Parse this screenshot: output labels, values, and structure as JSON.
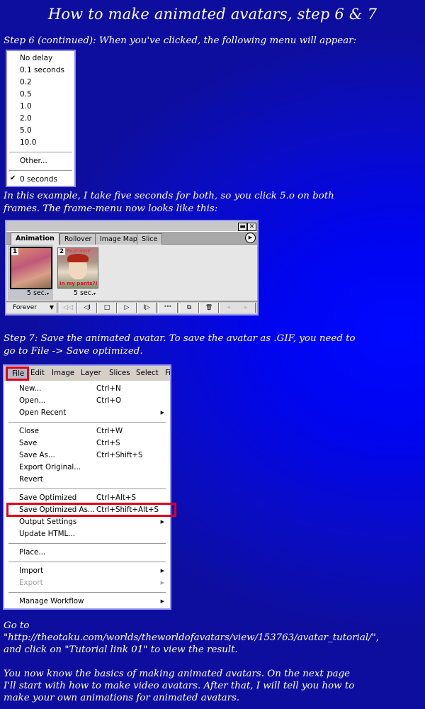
{
  "title": "How to make animated avatars, step 6 & 7",
  "step6_intro": "Step 6 (continued): When you've clicked, the following menu will appear:",
  "delay_menu": {
    "items": [
      "No delay",
      "0.1 seconds",
      "0.2",
      "0.5",
      "1.0",
      "2.0",
      "5.0",
      "10.0"
    ],
    "other": "Other...",
    "checked": "0 seconds",
    "check_glyph": "✔"
  },
  "example_text": {
    "line1": "In this example, I take five seconds for both, so you click 5.o on both",
    "line2": "frames. The frame-menu now looks like this:"
  },
  "animation_panel": {
    "minimize_glyph": "▬",
    "close_glyph": "✕",
    "tabs": [
      "Animation",
      "Rollover",
      "Image Map",
      "Slice"
    ],
    "active_tab": "Animation",
    "menu_glyph": "▶",
    "frames": [
      {
        "number": "1",
        "delay": "5 sec.",
        "selected": true
      },
      {
        "number": "2",
        "delay": "5 sec.",
        "selected": false,
        "caption_top": "Yourname",
        "caption_bottom": "In my pants?!"
      }
    ],
    "loop_option": "Forever",
    "dropdown_glyph": "▼",
    "controls": {
      "first": "◁◁",
      "prev": "◁I",
      "stop": "□",
      "play": "▷",
      "next": "I▷",
      "tween": "°°°",
      "duplicate": "⧉",
      "delete": "🗑"
    }
  },
  "step7_text": {
    "line1": "Step 7: Save the animated avatar. To save the avatar as .GIF, you need to",
    "line2": "go to File -> Save optimized."
  },
  "file_menu": {
    "menubar": [
      "File",
      "Edit",
      "Image",
      "Layer",
      "Slices",
      "Select",
      "Fil"
    ],
    "groups": [
      [
        {
          "label": "New...",
          "shortcut": "Ctrl+N"
        },
        {
          "label": "Open...",
          "shortcut": "Ctrl+O"
        },
        {
          "label": "Open Recent",
          "submenu": true
        }
      ],
      [
        {
          "label": "Close",
          "shortcut": "Ctrl+W"
        },
        {
          "label": "Save",
          "shortcut": "Ctrl+S"
        },
        {
          "label": "Save As...",
          "shortcut": "Ctrl+Shift+S"
        },
        {
          "label": "Export Original..."
        },
        {
          "label": "Revert"
        }
      ],
      [
        {
          "label": "Save Optimized",
          "shortcut": "Ctrl+Alt+S"
        },
        {
          "label": "Save Optimized As...",
          "shortcut": "Ctrl+Shift+Alt+S",
          "highlighted": true
        },
        {
          "label": "Output Settings",
          "submenu": true
        },
        {
          "label": "Update HTML..."
        }
      ],
      [
        {
          "label": "Place..."
        }
      ],
      [
        {
          "label": "Import",
          "submenu": true
        },
        {
          "label": "Export",
          "submenu": true,
          "disabled": true
        }
      ],
      [
        {
          "label": "Manage Workflow",
          "submenu": true
        }
      ]
    ],
    "submenu_glyph": "▶",
    "highlight_color": "#e0001a"
  },
  "result_text": {
    "line1": "Go to",
    "line2": "\"http://theotaku.com/worlds/theworldofavatars/view/153763/avatar_tutorial/\",",
    "line3": "and click on \"Tutorial link 01\" to view the result."
  },
  "closing_text": {
    "line1": "You now know the basics of making animated avatars. On the next page",
    "line2": "I'll start with how to make video avatars. After that, I will tell you how to",
    "line3": "make your own animations for animated avatars."
  },
  "colors": {
    "background": "#0707b8",
    "text": "#ffffff",
    "highlight": "#e0001a"
  }
}
